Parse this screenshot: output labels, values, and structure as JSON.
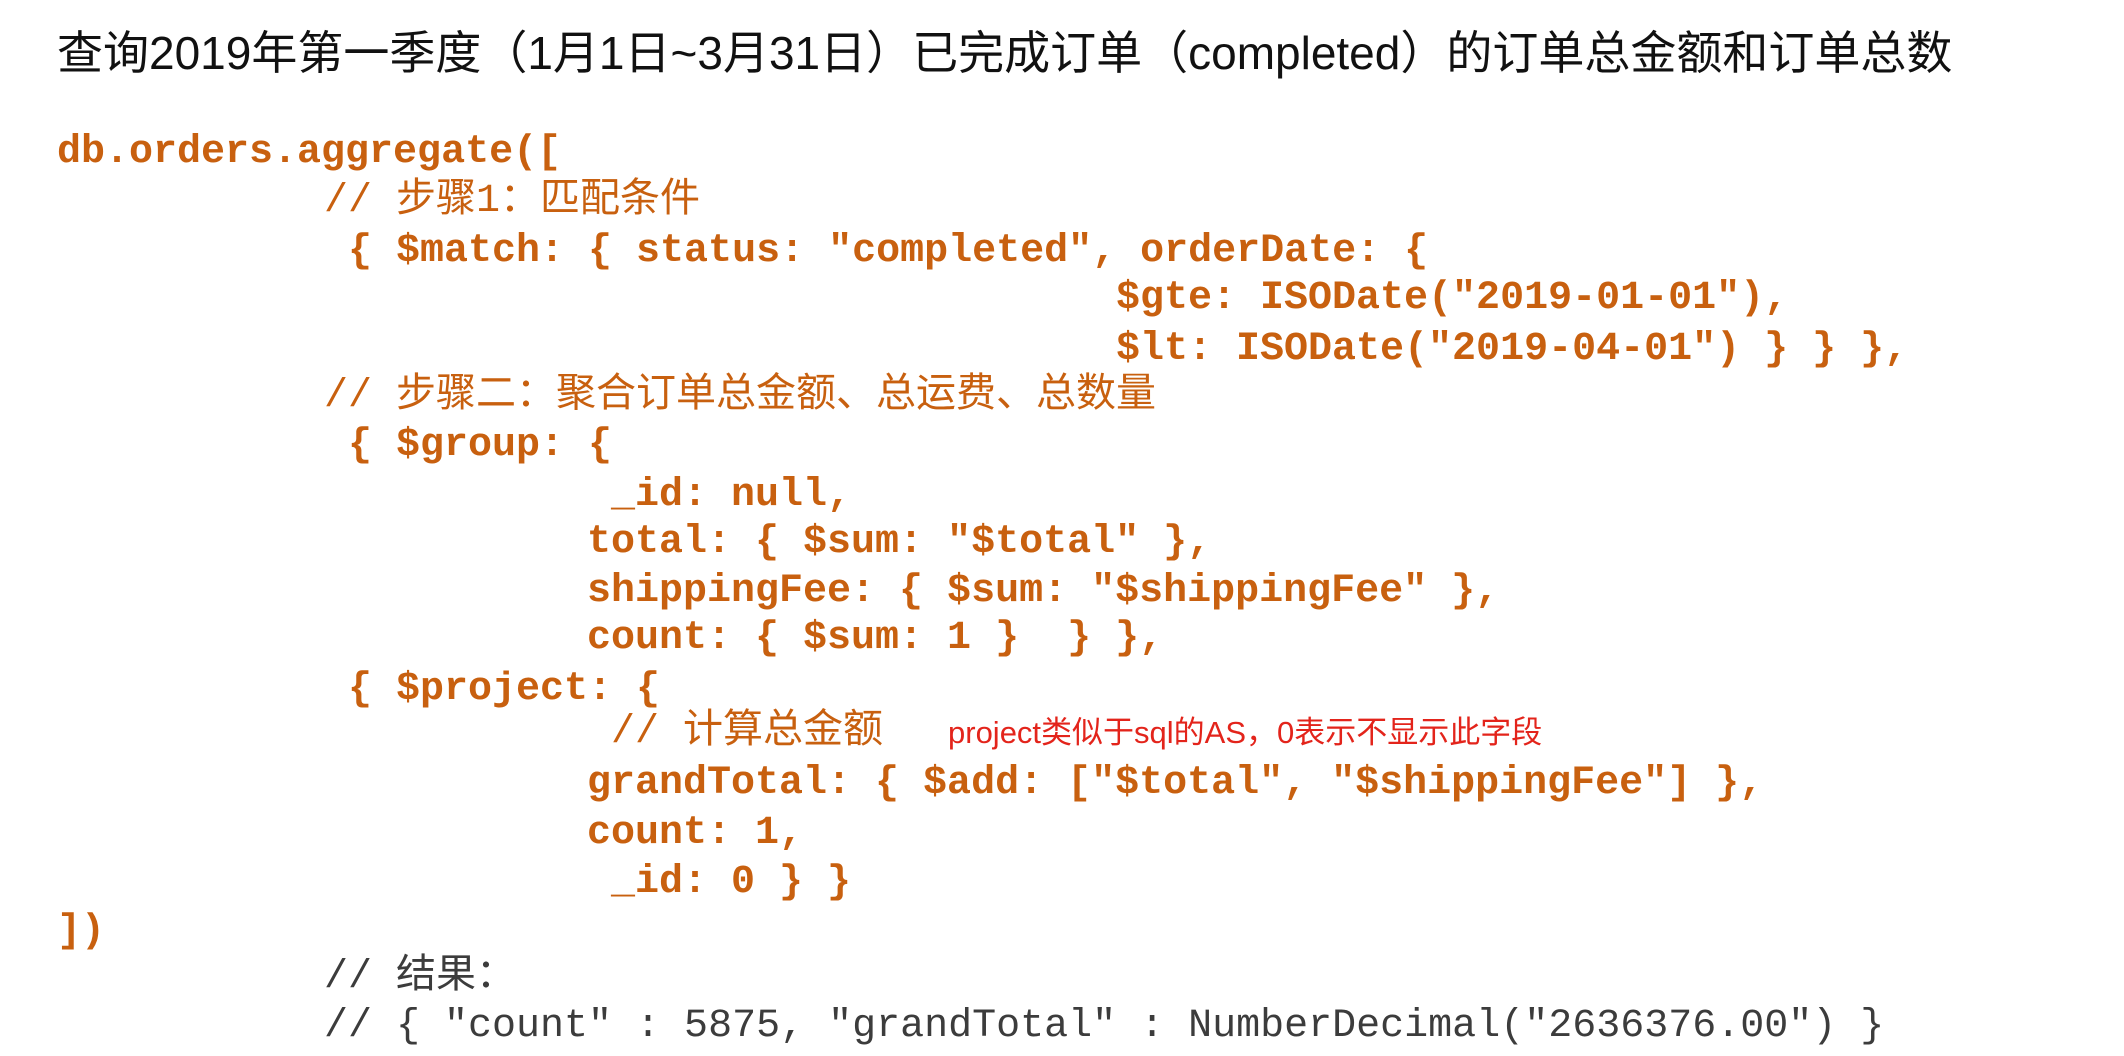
{
  "slide": {
    "title": "查询2019年第一季度（1月1日~3月31日）已完成订单（completed）的订单总金额和订单总数"
  },
  "code": {
    "aggregate_open": "db.orders.aggregate([",
    "comment_step1": "// 步骤1：匹配条件",
    "match_line": "{ $match: { status: \"completed\", orderDate: {",
    "match_gte": "$gte: ISODate(\"2019-01-01\"),",
    "match_lt": "$lt: ISODate(\"2019-04-01\") } } },",
    "comment_step2": "// 步骤二：聚合订单总金额、总运费、总数量",
    "group_open": "{ $group: {",
    "group_id": "_id: null,",
    "group_total": "total: { $sum: \"$total\" },",
    "group_shipping": "shippingFee: { $sum: \"$shippingFee\" },",
    "group_count": "count: { $sum: 1 }  } },",
    "project_open": "{ $project: {",
    "comment_project": "// 计算总金额",
    "project_grand_total": "grandTotal: { $add: [\"$total\", \"$shippingFee\"] },",
    "project_count": "count: 1,",
    "project_id": "_id: 0 } }",
    "aggregate_close": "])"
  },
  "annotation": "project类似于sql的AS，0表示不显示此字段",
  "result": {
    "label": "// 结果：",
    "value": "// { \"count\" : 5875, \"grandTotal\" : NumberDecimal(\"2636376.00\") }"
  },
  "colors": {
    "title": "#111111",
    "code": "#C8600F",
    "annotation": "#E3241B",
    "result": "#3C3C3C"
  }
}
